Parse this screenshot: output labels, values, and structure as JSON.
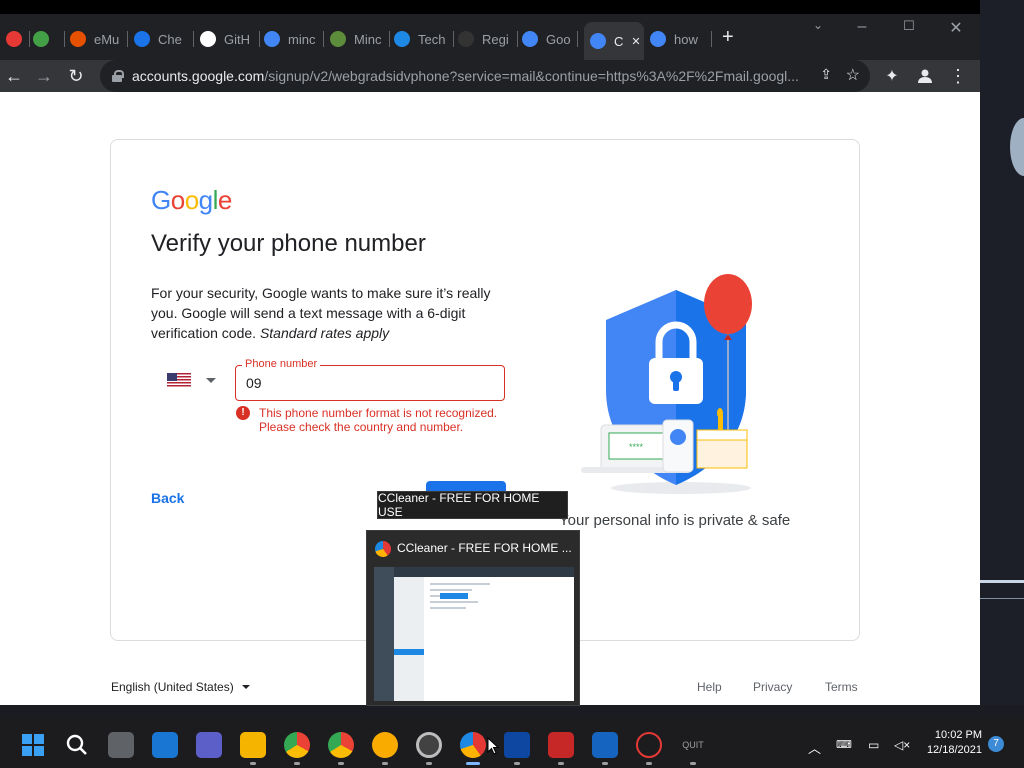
{
  "browser": {
    "tabs": [
      {
        "label": "",
        "icon": "ccleaner-icon",
        "color": "#e53935"
      },
      {
        "label": "",
        "icon": "check-icon",
        "color": "#43a047"
      },
      {
        "label": "eMu",
        "icon": "ccleaner-icon",
        "color": "#e65100"
      },
      {
        "label": "Che",
        "icon": "chrome-icon",
        "color": "#1a73e8"
      },
      {
        "label": "GitH",
        "icon": "github-icon",
        "color": "#ffffff"
      },
      {
        "label": "minc",
        "icon": "google-icon",
        "color": "#4285f4"
      },
      {
        "label": "Minc",
        "icon": "minecraft-icon",
        "color": "#5d8c3a"
      },
      {
        "label": "Tech",
        "icon": "tech-icon",
        "color": "#1e88e5"
      },
      {
        "label": "Regi",
        "icon": "epic-icon",
        "color": "#333333"
      },
      {
        "label": "Goo",
        "icon": "google-icon",
        "color": "#4285f4"
      },
      {
        "label": "C",
        "icon": "google-icon",
        "color": "#4285f4",
        "active": true
      },
      {
        "label": "how",
        "icon": "google-icon",
        "color": "#4285f4"
      }
    ],
    "url_host": "accounts.google.com",
    "url_path": "/signup/v2/webgradsidvphone?service=mail&continue=https%3A%2F%2Fmail.googl..."
  },
  "page": {
    "logo": [
      "G",
      "o",
      "o",
      "g",
      "l",
      "e"
    ],
    "heading": "Verify your phone number",
    "description": "For your security, Google wants to make sure it’s really you. Google will send a text message with a 6-digit verification code.",
    "description_italic": "Standard rates apply",
    "phone_label": "Phone number",
    "phone_value": "09",
    "error_line1": "This phone number format is not recognized.",
    "error_line2": "Please check the country and number.",
    "back_label": "Back",
    "illustration_caption": "Your personal info is private & safe",
    "card_stars": "****",
    "language": "English (United States)",
    "footer_links": [
      "Help",
      "Privacy",
      "Terms"
    ]
  },
  "overlay": {
    "tooltip": "CCleaner - FREE FOR HOME USE",
    "thumbnail_title": "CCleaner - FREE FOR HOME ..."
  },
  "taskbar": {
    "quit_label": "QUIT",
    "time": "10:02 PM",
    "date": "12/18/2021",
    "notifications": "7"
  },
  "colors": {
    "google_blue": "#4285f4",
    "google_red": "#ea4335",
    "google_yellow": "#fbbc05",
    "google_green": "#34a853",
    "error_red": "#d93025",
    "link_blue": "#1a73e8"
  }
}
